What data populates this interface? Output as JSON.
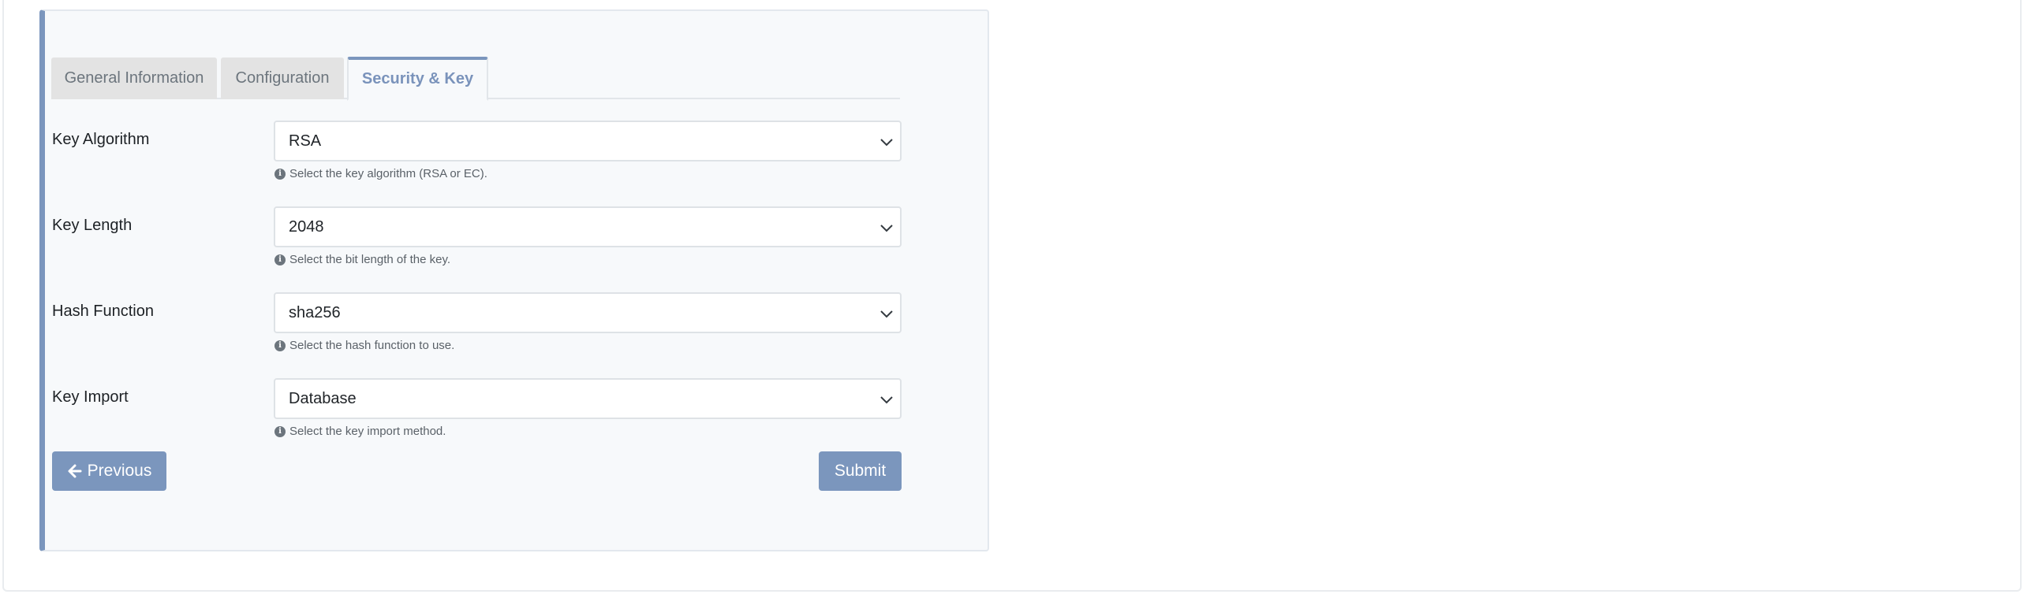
{
  "tabs": [
    {
      "label": "General Information"
    },
    {
      "label": "Configuration"
    },
    {
      "label": "Security & Key",
      "active": true
    }
  ],
  "fields": [
    {
      "label": "Key Algorithm",
      "value": "RSA",
      "help": "Select the key algorithm (RSA or EC)."
    },
    {
      "label": "Key Length",
      "value": "2048",
      "help": "Select the bit length of the key."
    },
    {
      "label": "Hash Function",
      "value": "sha256",
      "help": "Select the hash function to use."
    },
    {
      "label": "Key Import",
      "value": "Database",
      "help": "Select the key import method."
    }
  ],
  "buttons": {
    "previous": "Previous",
    "submit": "Submit"
  },
  "icons": {
    "info": "info-circle-icon",
    "chevron": "chevron-down-icon",
    "arrow": "arrow-left-icon"
  },
  "colors": {
    "accent": "#7b96bd",
    "tab_active_text": "#7a93bb"
  }
}
